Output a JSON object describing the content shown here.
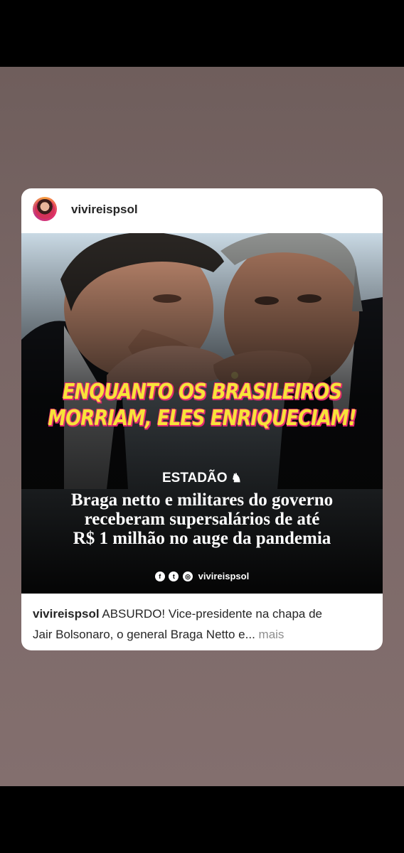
{
  "post": {
    "username": "vivireispsol",
    "headline_line1": "ENQUANTO OS BRASILEIROS",
    "headline_line2": "MORRIAM, ELES ENRIQUECIAM!",
    "source": "ESTADÃO",
    "subtitle_line1": "Braga netto e militares do governo",
    "subtitle_line2": "receberam supersalários de até",
    "subtitle_line3": "R$ 1 milhão no auge da pandemia",
    "social_handle": "vivireispsol",
    "caption_user": "vivireispsol",
    "caption_text_line1": "ABSURDO! Vice-presidente na chapa de",
    "caption_text_line2": "Jair Bolsonaro, o general Braga Netto e",
    "caption_ellipsis": "...",
    "caption_more": "mais"
  },
  "icons": {
    "avatar": "profile-avatar",
    "estadao_logo": "horse-rider-icon",
    "facebook": "facebook-icon",
    "twitter": "twitter-icon",
    "instagram": "instagram-icon"
  },
  "colors": {
    "headline": "#f7e33a",
    "headline_outline": "#e1286f",
    "story_background": "#7a6766"
  }
}
